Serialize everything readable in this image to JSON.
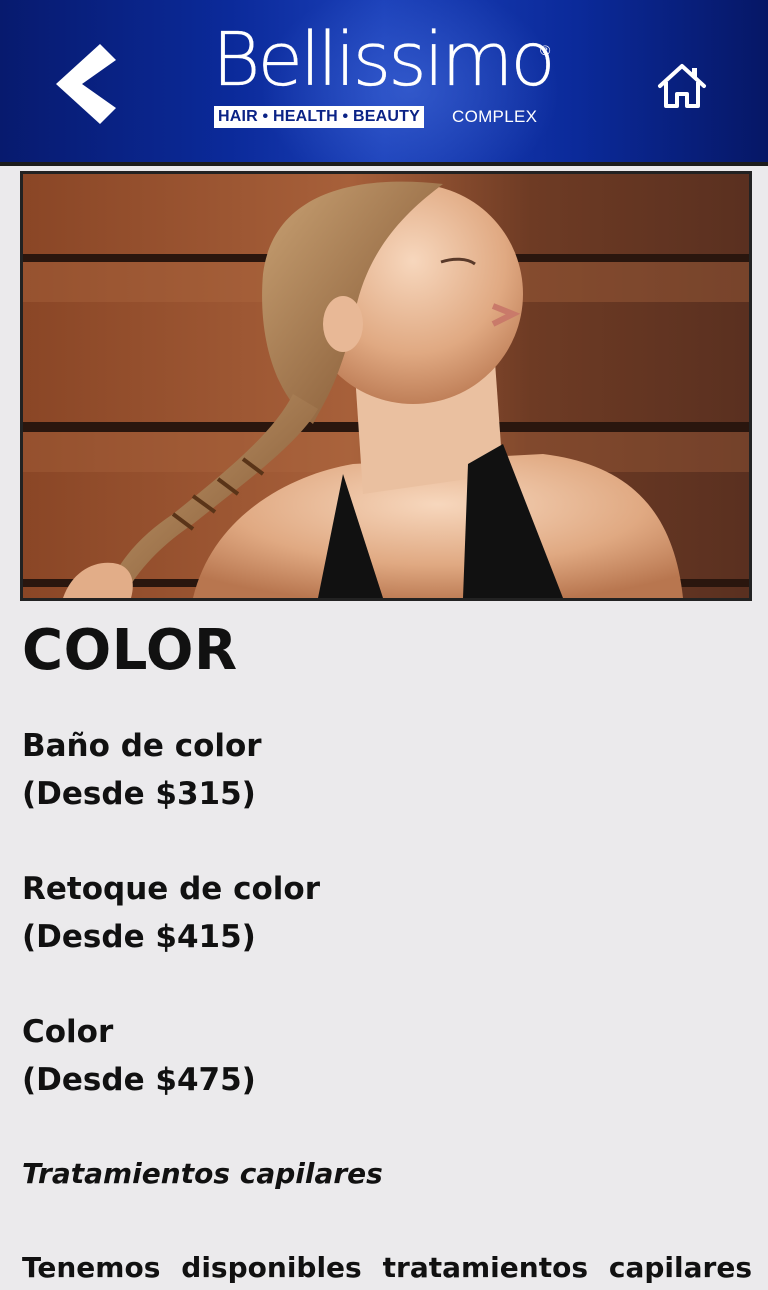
{
  "header": {
    "logo": {
      "wordmark": "Bellissimo",
      "registered_mark": "®",
      "tagline_boxed": "HAIR • HEALTH • BEAUTY",
      "tagline_suffix": "COMPLEX"
    },
    "back_icon": "chevron-left-icon",
    "home_icon": "home-icon",
    "colors": {
      "header_bg": "#0b2a9a",
      "icon": "#ffffff"
    }
  },
  "hero": {
    "image_subject": "woman-with-braided-hair-photo"
  },
  "content": {
    "title": "COLOR",
    "services": [
      {
        "name": "Baño de color",
        "price": "(Desde $315)"
      },
      {
        "name": "Retoque de color",
        "price": "(Desde $415)"
      },
      {
        "name": "Color",
        "price": "(Desde $475)"
      }
    ],
    "subsection_title": "Tratamientos capilares",
    "paragraph": "Tenemos disponibles tratamientos capilares"
  }
}
